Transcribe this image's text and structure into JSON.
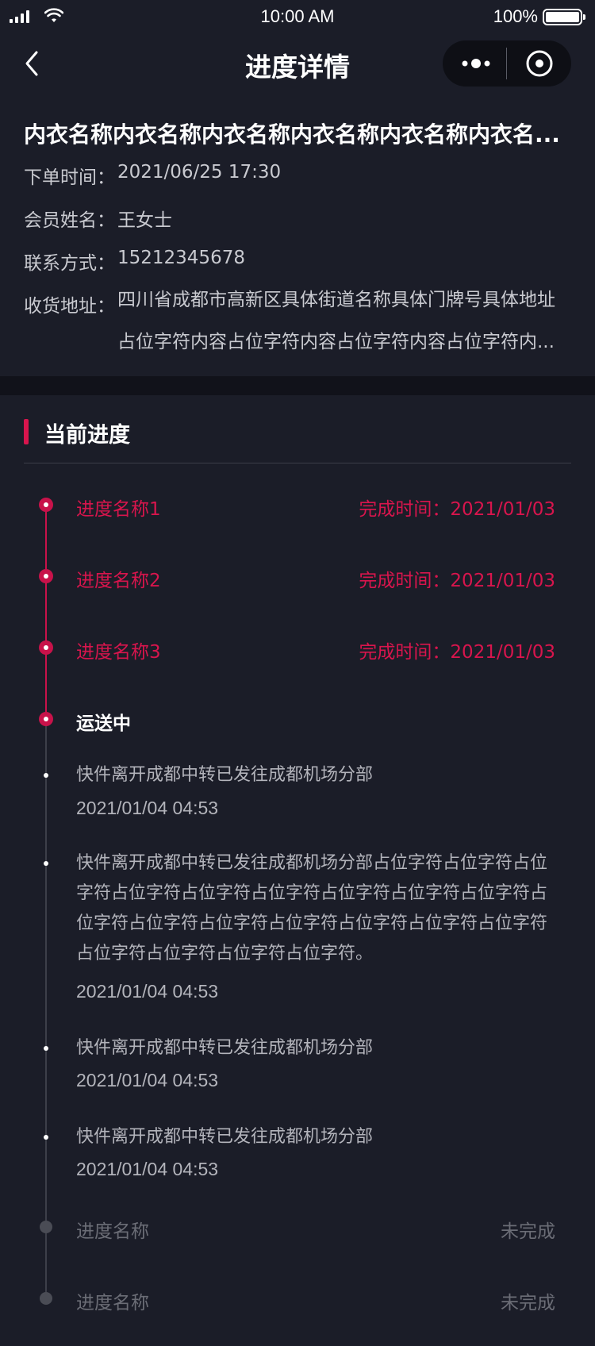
{
  "status_bar": {
    "time": "10:00 AM",
    "battery": "100%"
  },
  "nav": {
    "title": "进度详情"
  },
  "order": {
    "product_name": "内衣名称内衣名称内衣名称内衣名称内衣名称内衣名...",
    "order_time_label": "下单时间：",
    "order_time": "2021/06/25 17:30",
    "member_label": "会员姓名：",
    "member_name": "王女士",
    "contact_label": "联系方式：",
    "contact": "15212345678",
    "address_label": "收货地址：",
    "address_line1": "四川省成都市高新区具体街道名称具体门牌号具体地址",
    "address_line2": "占位字符内容占位字符内容占位字符内容占位字符内..."
  },
  "progress": {
    "section_title": "当前进度",
    "completed_steps": [
      {
        "name": "进度名称1",
        "time": "完成时间：2021/01/03"
      },
      {
        "name": "进度名称2",
        "time": "完成时间：2021/01/03"
      },
      {
        "name": "进度名称3",
        "time": "完成时间：2021/01/03"
      }
    ],
    "current_step": {
      "name": "运送中"
    },
    "logs": [
      {
        "text": "快件离开成都中转已发往成都机场分部",
        "time": "2021/01/04 04:53"
      },
      {
        "text": "快件离开成都中转已发往成都机场分部占位字符占位字符占位字符占位字符占位字符占位字符占位字符占位字符占位字符占位字符占位字符占位字符占位字符占位字符占位字符占位字符占位字符占位字符占位字符占位字符。",
        "time": "2021/01/04 04:53"
      },
      {
        "text": "快件离开成都中转已发往成都机场分部",
        "time": "2021/01/04 04:53"
      },
      {
        "text": "快件离开成都中转已发往成都机场分部",
        "time": "2021/01/04 04:53"
      }
    ],
    "pending_steps": [
      {
        "name": "进度名称",
        "status": "未完成"
      },
      {
        "name": "进度名称",
        "status": "未完成"
      }
    ]
  },
  "colors": {
    "accent": "#d8154d",
    "background": "#1b1d28",
    "band": "#11121a"
  }
}
